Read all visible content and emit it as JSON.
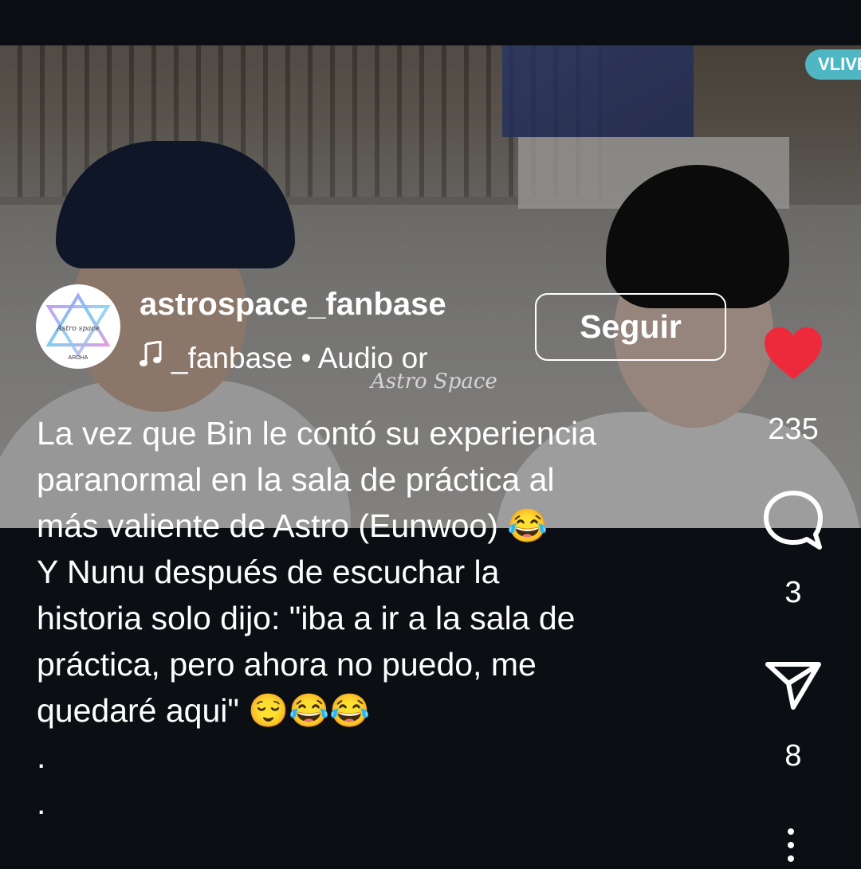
{
  "video": {
    "badge": "VLIVE",
    "watermark": "Astro Space"
  },
  "header": {
    "avatar": {
      "text_top": "Astro space",
      "text_bottom": "AROHA"
    },
    "username": "astrospace_fanbase",
    "audio_text": "_fanbase • Audio or",
    "follow_label": "Seguir"
  },
  "caption": {
    "lines": [
      "La vez que Bin le contó su experiencia",
      "paranormal en la sala de práctica al",
      "más valiente de Astro (Eunwoo) 😂",
      "Y Nunu después de escuchar la",
      "historia solo dijo: \"iba a ir a la sala de",
      "práctica, pero ahora no puedo, me",
      "quedaré aqui\" 😌😂😂",
      ".",
      "."
    ]
  },
  "actions": {
    "likes": "235",
    "comments": "3",
    "shares": "8"
  },
  "colors": {
    "background": "#0b0f14",
    "like": "#ed2a3b",
    "text": "#ffffff"
  }
}
